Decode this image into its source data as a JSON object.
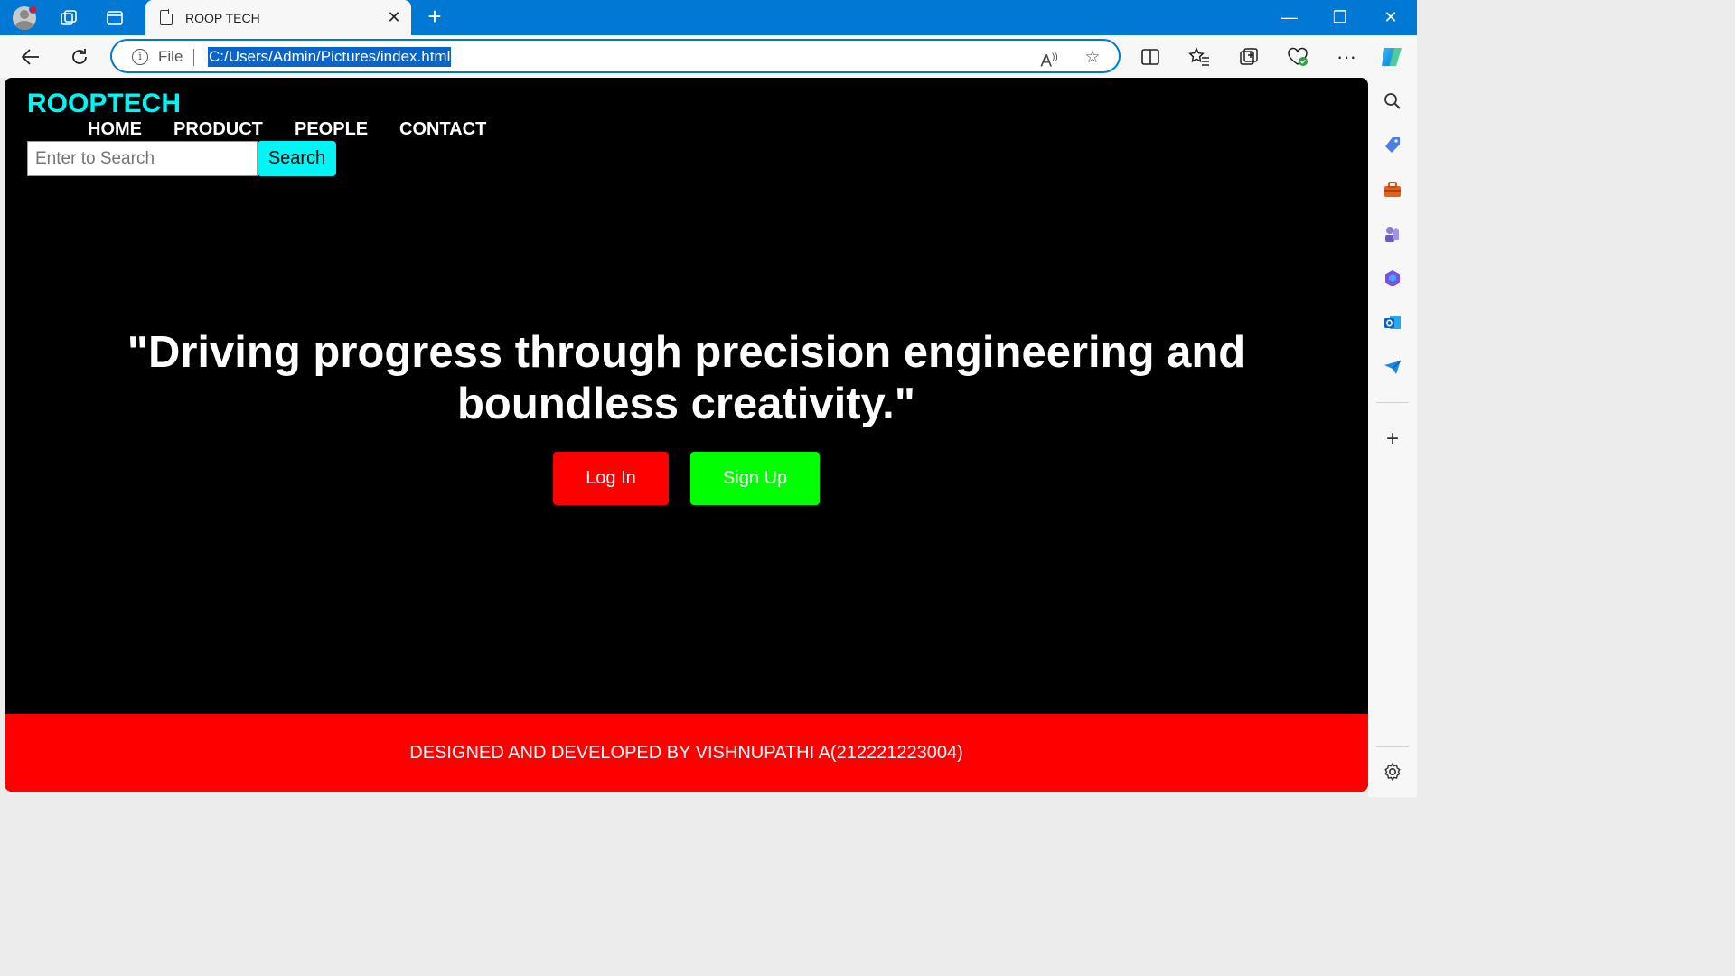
{
  "browser": {
    "tab_title": "ROOP TECH",
    "tab_close": "✕",
    "new_tab": "+",
    "address_scheme": "File",
    "url": "C:/Users/Admin/Pictures/index.html",
    "window_controls": {
      "minimize": "—",
      "restore": "❐",
      "close": "✕"
    },
    "nav_icons": [
      "back-arrow-icon",
      "refresh-icon"
    ],
    "toolbar_icons": [
      "read-aloud-icon",
      "favorite-star-icon",
      "split-screen-icon",
      "favorites-icon",
      "collections-icon",
      "browser-essentials-icon",
      "more-icon",
      "copilot-icon"
    ],
    "sidebar_icons": [
      "search-icon",
      "shopping-icon",
      "tools-icon",
      "games-icon",
      "microsoft-365-icon",
      "outlook-icon",
      "drop-icon",
      "add-icon",
      "settings-icon"
    ]
  },
  "site": {
    "brand": "ROOPTECH",
    "brand_color": "#00f5f5",
    "nav": [
      "HOME",
      "PRODUCT",
      "PEOPLE",
      "CONTACT"
    ],
    "search": {
      "placeholder": "Enter to Search",
      "button": "Search"
    },
    "tagline_line1": "\"Driving progress through precision engineering and",
    "tagline_line2": "boundless creativity.\"",
    "login_button": "Log In",
    "signup_button": "Sign Up",
    "footer_text": "DESIGNED AND DEVELOPED BY VISHNUPATHI A(212221223004)",
    "colors": {
      "login": "#ff0000",
      "signup": "#00ff00",
      "footer": "#ff0000",
      "background": "#000000"
    }
  }
}
